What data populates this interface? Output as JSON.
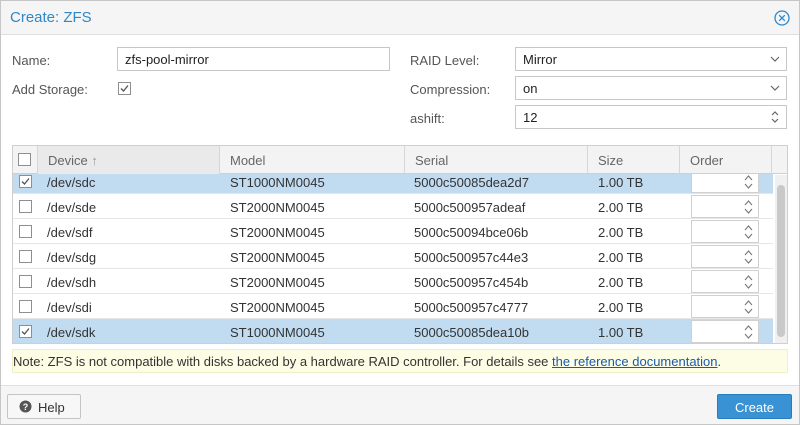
{
  "dialog": {
    "title": "Create: ZFS"
  },
  "form": {
    "name_label": "Name:",
    "name_value": "zfs-pool-mirror",
    "add_storage_label": "Add Storage:",
    "add_storage_checked": true,
    "raid_label": "RAID Level:",
    "raid_value": "Mirror",
    "compression_label": "Compression:",
    "compression_value": "on",
    "ashift_label": "ashift:",
    "ashift_value": "12"
  },
  "grid": {
    "columns": [
      "Device",
      "Model",
      "Serial",
      "Size",
      "Order"
    ],
    "sort_indicator": "↑",
    "rows": [
      {
        "device": "/dev/sdc",
        "model": "ST1000NM0045",
        "serial": "5000c50085dea2d7",
        "size": "1.00 TB",
        "checked": true
      },
      {
        "device": "/dev/sde",
        "model": "ST2000NM0045",
        "serial": "5000c500957adeaf",
        "size": "2.00 TB",
        "checked": false
      },
      {
        "device": "/dev/sdf",
        "model": "ST2000NM0045",
        "serial": "5000c50094bce06b",
        "size": "2.00 TB",
        "checked": false
      },
      {
        "device": "/dev/sdg",
        "model": "ST2000NM0045",
        "serial": "5000c500957c44e3",
        "size": "2.00 TB",
        "checked": false
      },
      {
        "device": "/dev/sdh",
        "model": "ST2000NM0045",
        "serial": "5000c500957c454b",
        "size": "2.00 TB",
        "checked": false
      },
      {
        "device": "/dev/sdi",
        "model": "ST2000NM0045",
        "serial": "5000c500957c4777",
        "size": "2.00 TB",
        "checked": false
      },
      {
        "device": "/dev/sdk",
        "model": "ST1000NM0045",
        "serial": "5000c50085dea10b",
        "size": "1.00 TB",
        "checked": true
      }
    ]
  },
  "note": {
    "text": "Note: ZFS is not compatible with disks backed by a hardware RAID controller. For details see ",
    "link": "the reference documentation",
    "suffix": "."
  },
  "footer": {
    "help_label": "Help",
    "create_label": "Create"
  },
  "colors": {
    "accent": "#2e88c9",
    "selected_row": "#c1dbf0",
    "primary_button": "#3892d4",
    "note_bg": "#fdfde6"
  }
}
